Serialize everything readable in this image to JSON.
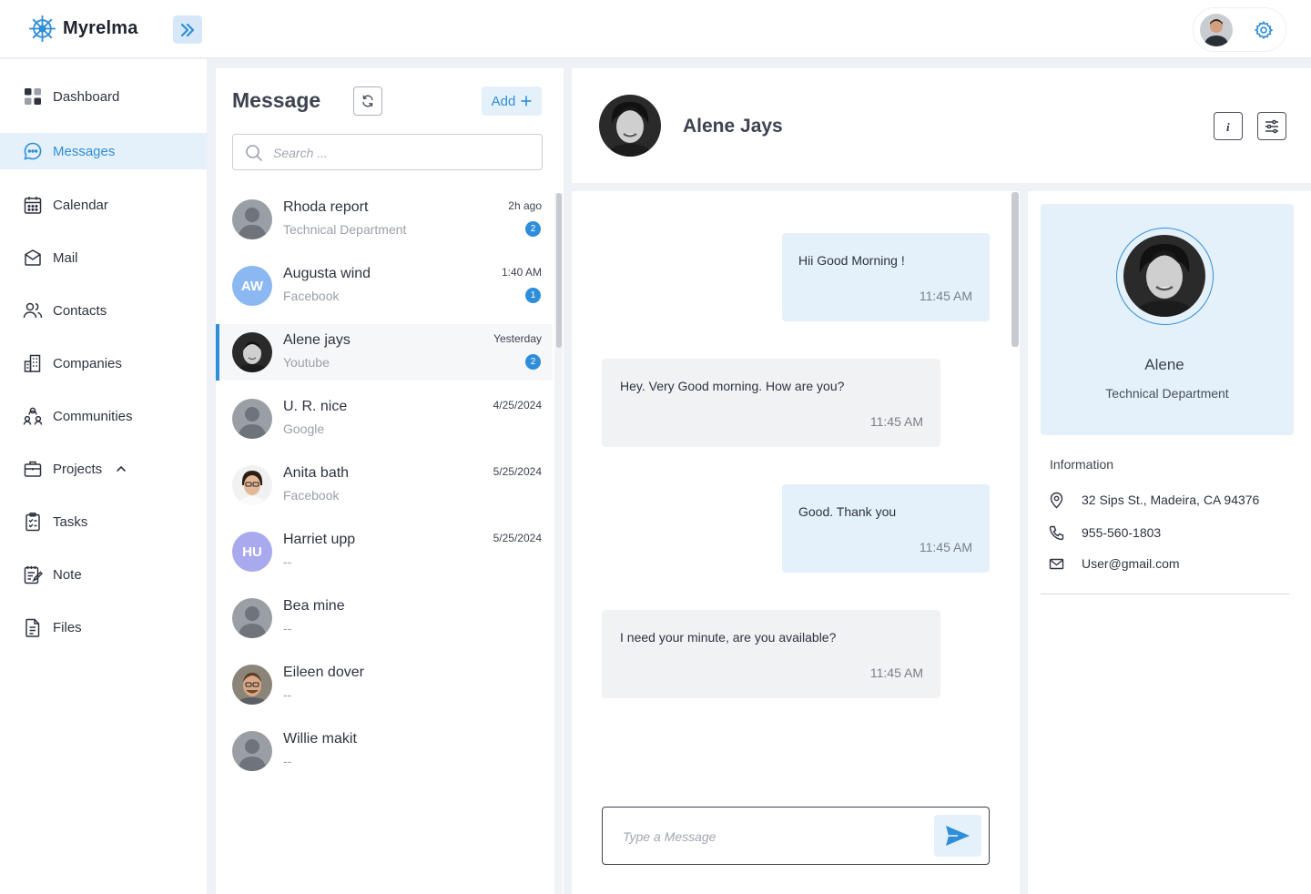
{
  "app": {
    "name": "Myrelma"
  },
  "sidebar": {
    "items": [
      {
        "label": "Dashboard",
        "icon": "dashboard-icon"
      },
      {
        "label": "Messages",
        "icon": "chat-icon",
        "active": true
      },
      {
        "label": "Calendar",
        "icon": "calendar-icon"
      },
      {
        "label": "Mail",
        "icon": "mail-icon"
      },
      {
        "label": "Contacts",
        "icon": "contacts-icon"
      },
      {
        "label": "Companies",
        "icon": "building-icon"
      },
      {
        "label": "Communities",
        "icon": "community-icon"
      },
      {
        "label": "Projects",
        "icon": "briefcase-icon"
      },
      {
        "label": "Tasks",
        "icon": "clipboard-icon"
      },
      {
        "label": "Note",
        "icon": "note-icon"
      },
      {
        "label": "Files",
        "icon": "file-icon"
      }
    ]
  },
  "messages_panel": {
    "title": "Message",
    "add_label": "Add",
    "search_placeholder": "Search ...",
    "contacts": [
      {
        "name": "Rhoda report",
        "sub": "Technical Department",
        "time": "2h ago",
        "badge": "2",
        "avatar": "placeholder"
      },
      {
        "name": "Augusta wind",
        "sub": "Facebook",
        "time": "1:40 AM",
        "badge": "1",
        "avatar": "initials",
        "initials": "AW",
        "avatar_color": "#8cb8f2"
      },
      {
        "name": "Alene jays",
        "sub": "Youtube",
        "time": "Yesterday",
        "badge": "2",
        "avatar": "photo",
        "active": true
      },
      {
        "name": "U. R. nice",
        "sub": "Google",
        "time": "4/25/2024",
        "badge": "",
        "avatar": "placeholder"
      },
      {
        "name": "Anita bath",
        "sub": "Facebook",
        "time": "5/25/2024",
        "badge": "",
        "avatar": "photo2"
      },
      {
        "name": "Harriet upp",
        "sub": "--",
        "time": "5/25/2024",
        "badge": "",
        "avatar": "initials",
        "initials": "HU",
        "avatar_color": "#a9a9ee"
      },
      {
        "name": "Bea mine",
        "sub": "--",
        "time": "",
        "badge": "",
        "avatar": "placeholder"
      },
      {
        "name": "Eileen dover",
        "sub": "--",
        "time": "",
        "badge": "",
        "avatar": "photo3"
      },
      {
        "name": "Willie makit",
        "sub": "--",
        "time": "",
        "badge": "",
        "avatar": "placeholder"
      }
    ]
  },
  "chat": {
    "contact_name": "Alene Jays",
    "messages": [
      {
        "direction": "out",
        "text": "Hii Good Morning !",
        "time": "11:45 AM"
      },
      {
        "direction": "in",
        "text": "Hey. Very Good morning. How are you?",
        "time": "11:45 AM"
      },
      {
        "direction": "out",
        "text": "Good. Thank you",
        "time": "11:45 AM"
      },
      {
        "direction": "in",
        "text": "I need your minute, are you available?",
        "time": "11:45 AM"
      }
    ],
    "composer_placeholder": "Type a Message"
  },
  "profile": {
    "name": "Alene",
    "department": "Technical Department",
    "info_title": "Information",
    "address": "32 Sips St., Madeira, CA 94376",
    "phone": "955-560-1803",
    "email": "User@gmail.com"
  },
  "colors": {
    "accent": "#2f8ed9",
    "accent_light": "#e4f0fa",
    "background": "#eef1f5"
  }
}
